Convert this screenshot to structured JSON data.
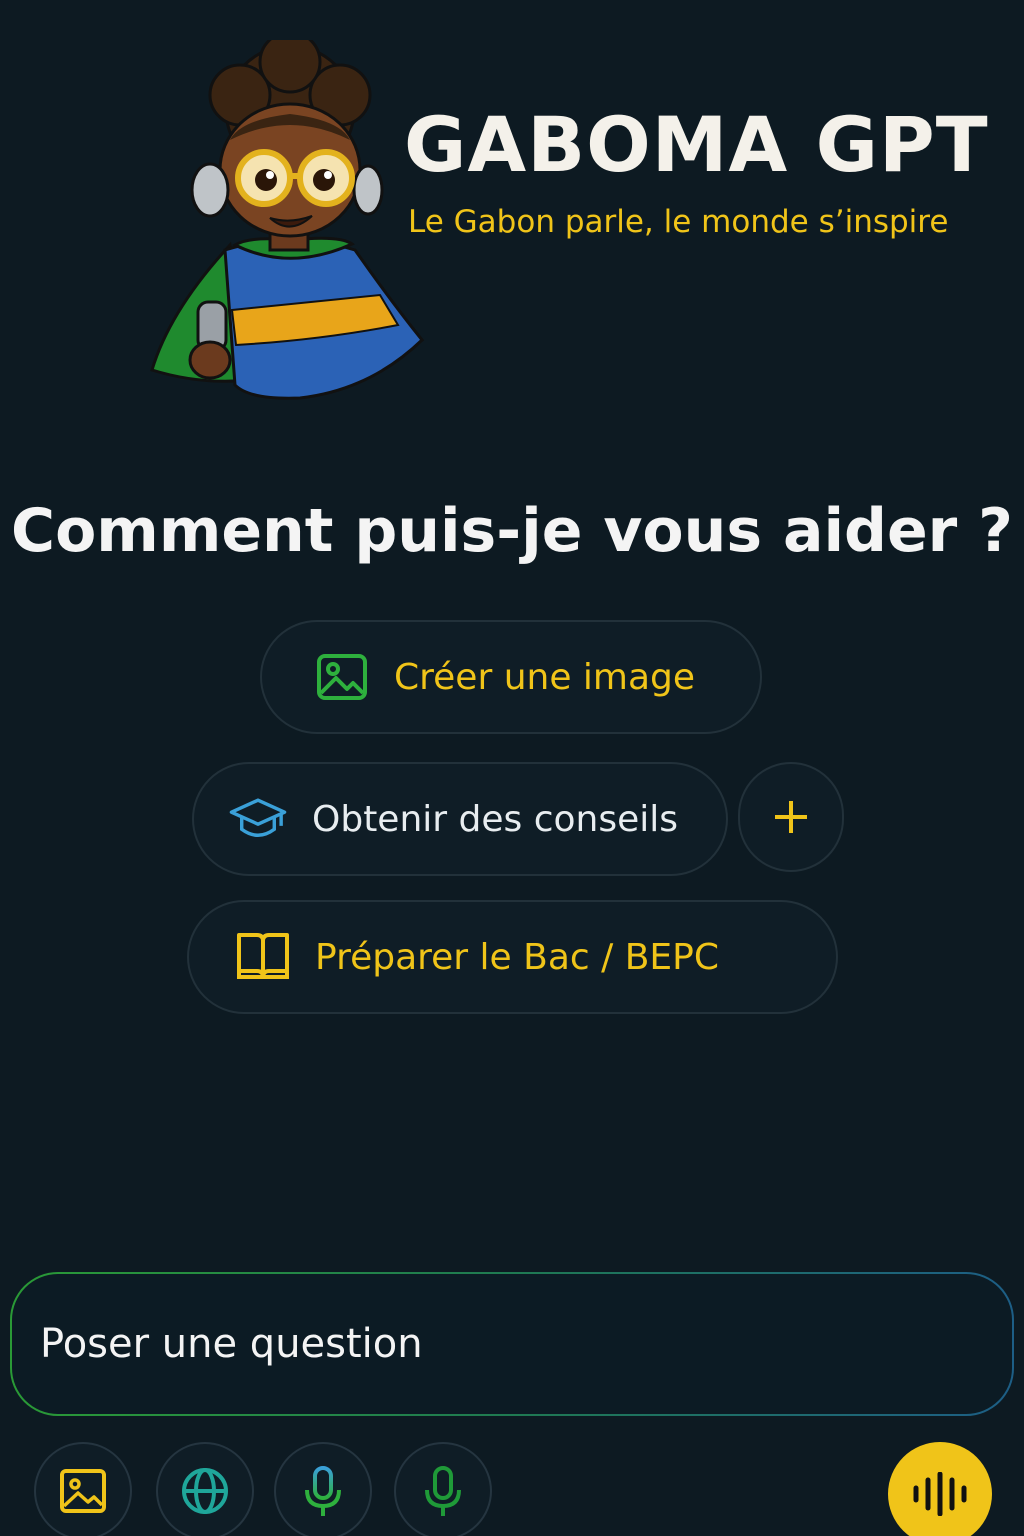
{
  "header": {
    "title": "GABOMA GPT",
    "tagline": "Le Gabon parle, le monde s’inspire",
    "mascot": "gabonese-boy-mascot"
  },
  "main": {
    "heading": "Comment puis-je vous aider ?",
    "suggestions": [
      {
        "label": "Créer une image",
        "icon": "image-icon"
      },
      {
        "label": "Obtenir des conseils",
        "icon": "graduation-cap-icon"
      },
      {
        "label": "Préparer le Bac / BEPC",
        "icon": "book-icon"
      }
    ],
    "more_label": "+"
  },
  "composer": {
    "placeholder": "Poser une question"
  },
  "toolbar": {
    "buttons": [
      "image-icon",
      "globe-icon",
      "microphone-icon",
      "microphone-icon"
    ],
    "voice": "voice-waveform-icon"
  },
  "colors": {
    "background": "#0d1a22",
    "accent_yellow": "#f0c419",
    "green": "#2eb03d",
    "blue": "#3aa0d8",
    "teal": "#1fa69a"
  }
}
